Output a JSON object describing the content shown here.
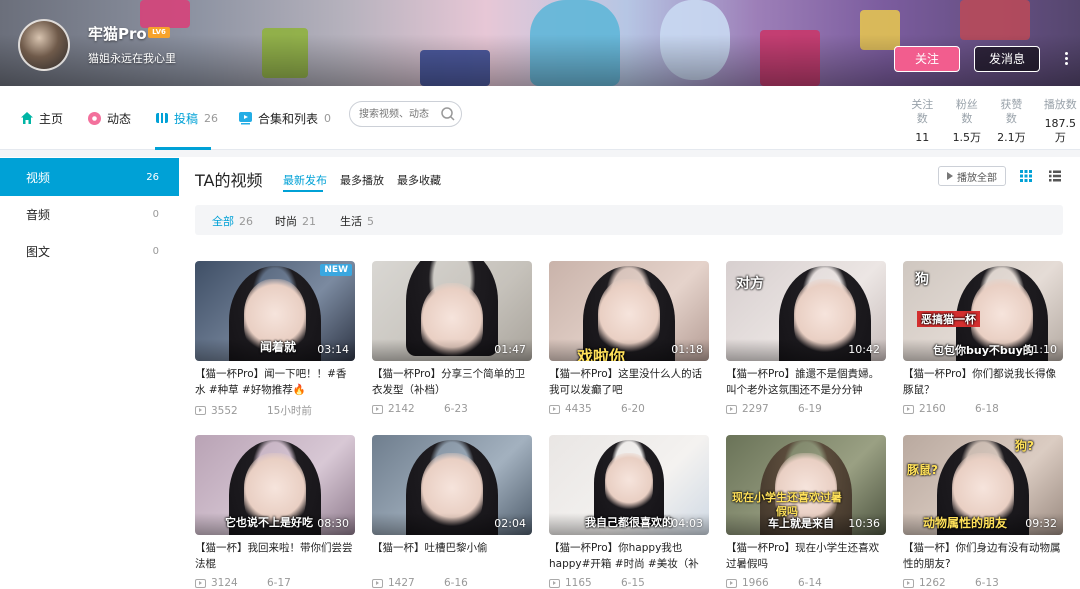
{
  "profile": {
    "name": "牢猫Pro",
    "level": "LV6",
    "sign": "猫姐永远在我心里",
    "follow_label": "关注",
    "message_label": "发消息"
  },
  "nav": {
    "items": [
      {
        "label": "主页",
        "count": ""
      },
      {
        "label": "动态",
        "count": ""
      },
      {
        "label": "投稿",
        "count": "26"
      },
      {
        "label": "合集和列表",
        "count": "0"
      }
    ],
    "search_placeholder": "搜索视频、动态"
  },
  "stats": [
    {
      "label": "关注数",
      "value": "11"
    },
    {
      "label": "粉丝数",
      "value": "1.5万"
    },
    {
      "label": "获赞数",
      "value": "2.1万"
    },
    {
      "label": "播放数",
      "value": "187.5万"
    }
  ],
  "sidebar": {
    "items": [
      {
        "label": "视频",
        "count": "26"
      },
      {
        "label": "音频",
        "count": "0"
      },
      {
        "label": "图文",
        "count": "0"
      }
    ]
  },
  "main": {
    "title": "TA的视频",
    "sort_tabs": [
      "最新发布",
      "最多播放",
      "最多收藏"
    ],
    "play_all": "播放全部",
    "filters": [
      {
        "label": "全部",
        "count": "26"
      },
      {
        "label": "时尚",
        "count": "21"
      },
      {
        "label": "生活",
        "count": "5"
      }
    ]
  },
  "videos": [
    {
      "title": "【猫一杯Pro】闻一下吧！！#香水 #种草 #好物推荐🔥",
      "views": "3552",
      "date": "15小时前",
      "duration": "03:14",
      "overlay": "闻着就",
      "badge": "NEW"
    },
    {
      "title": "【猫一杯Pro】分享三个简单的卫衣发型（补档）",
      "views": "2142",
      "date": "6-23",
      "duration": "01:47",
      "overlay": "",
      "badge": ""
    },
    {
      "title": "【猫一杯Pro】这里没什么人的话我可以发癫了吧",
      "views": "4435",
      "date": "6-20",
      "duration": "01:18",
      "overlay": "戏啦你",
      "badge": ""
    },
    {
      "title": "【猫一杯Pro】誰還不是個貴婦。叫个老外这氛围还不是分分钟get！",
      "views": "2297",
      "date": "6-19",
      "duration": "10:42",
      "overlay": "对方",
      "badge": ""
    },
    {
      "title": "【猫一杯Pro】你们都说我长得像豚鼠？",
      "views": "2160",
      "date": "6-18",
      "duration": "11:10",
      "overlay": "包包你buy不buy的",
      "overlay2": "恶搞猫一杯",
      "overlay3": "狗",
      "badge": ""
    },
    {
      "title": "【猫一杯】我回来啦！带你们尝尝法棍",
      "views": "3124",
      "date": "6-17",
      "duration": "08:30",
      "overlay": "它也说不上是好吃",
      "badge": ""
    },
    {
      "title": "【猫一杯】吐槽巴黎小偷",
      "views": "1427",
      "date": "6-16",
      "duration": "02:04",
      "overlay": "",
      "badge": ""
    },
    {
      "title": "【猫一杯Pro】你happy我也happy#开箱 #时尚 #美妆（补档）",
      "views": "1165",
      "date": "6-15",
      "duration": "04:03",
      "overlay": "我自己都很喜欢的",
      "badge": ""
    },
    {
      "title": "【猫一杯Pro】现在小学生还喜欢过暑假吗",
      "views": "1966",
      "date": "6-14",
      "duration": "10:36",
      "overlay": "车上就是来自",
      "overlay2": "现在小学生还喜欢过暑假吗",
      "badge": ""
    },
    {
      "title": "【猫一杯】你们身边有没有动物属性的朋友?",
      "views": "1262",
      "date": "6-13",
      "duration": "09:32",
      "overlay": "动物属性的朋友",
      "overlay2": "豚鼠?",
      "overlay3": "狗?",
      "badge": ""
    }
  ],
  "colors": {
    "accent": "#00a1d6",
    "follow": "#f25d8e",
    "sidebar_active": "#00a1d6"
  }
}
